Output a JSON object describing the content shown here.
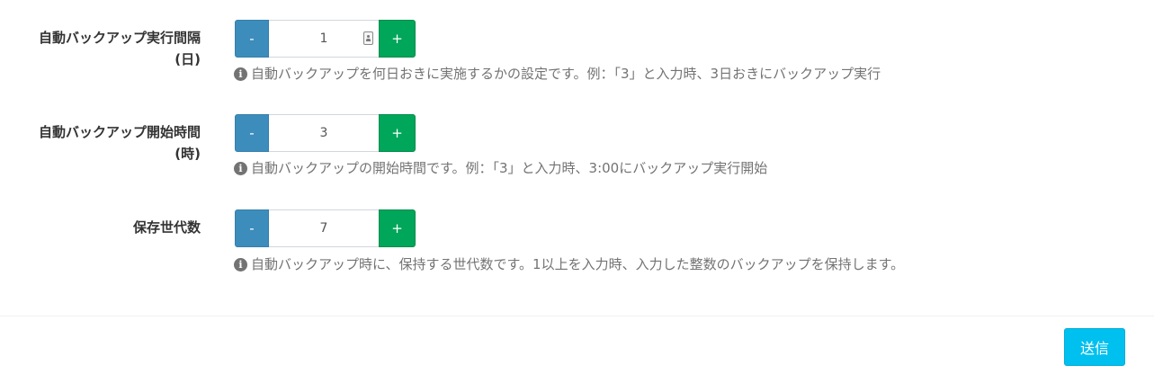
{
  "fields": [
    {
      "label_line1": "自動バックアップ実行間隔",
      "label_line2": "(日)",
      "minus_label": "-",
      "value": "1",
      "plus_label": "+",
      "help_icon": "i",
      "help_text": "自動バックアップを何日おきに実施するかの設定です。例：「3」と入力時、3日おきにバックアップ実行"
    },
    {
      "label_line1": "自動バックアップ開始時間",
      "label_line2": "(時)",
      "minus_label": "-",
      "value": "3",
      "plus_label": "+",
      "help_icon": "i",
      "help_text": "自動バックアップの開始時間です。例：「3」と入力時、3:00にバックアップ実行開始"
    },
    {
      "label_line1": "保存世代数",
      "minus_label": "-",
      "value": "7",
      "plus_label": "+",
      "help_icon": "i",
      "help_text": "自動バックアップ時に、保持する世代数です。1以上を入力時、入力した整数のバックアップを保持します。"
    }
  ],
  "footer": {
    "submit_label": "送信"
  },
  "colors": {
    "minus_button": "#3c8dbc",
    "plus_button": "#00a65a",
    "submit_button": "#00c0ef"
  }
}
